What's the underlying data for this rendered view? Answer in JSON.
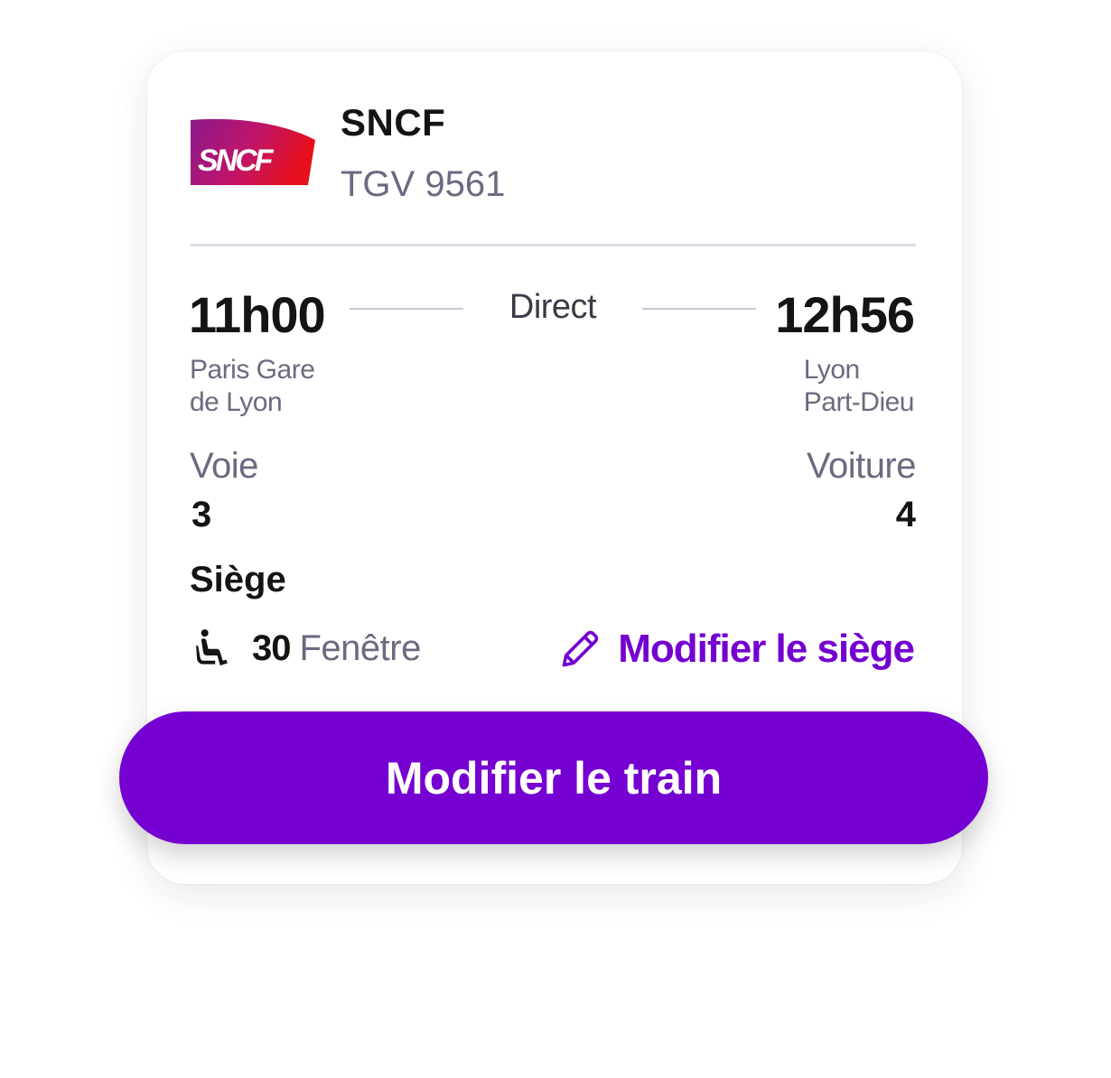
{
  "carrier": {
    "logo_text": "SNCF",
    "name": "SNCF",
    "train_number": "TGV 9561"
  },
  "journey": {
    "departure_time": "11h00",
    "arrival_time": "12h56",
    "connection": "Direct",
    "departure_station_line1": "Paris Gare",
    "departure_station_line2": "de Lyon",
    "arrival_station_line1": "Lyon",
    "arrival_station_line2": "Part-Dieu"
  },
  "details": {
    "track_label": "Voie",
    "track_value": "3",
    "coach_label": "Voiture",
    "coach_value": "4"
  },
  "seat": {
    "heading": "Siège",
    "icon": "seat-icon",
    "number": "30",
    "type": "Fenêtre",
    "edit_label": "Modifier le siège",
    "edit_icon": "pencil-icon"
  },
  "actions": {
    "change_train_label": "Modifier le train"
  },
  "colors": {
    "accent": "#7500d1",
    "link": "#7300d0",
    "text_primary": "#141414",
    "text_secondary": "#6a6a80",
    "logo_gradient_start": "#8a1a8c",
    "logo_gradient_end": "#e0101e"
  }
}
